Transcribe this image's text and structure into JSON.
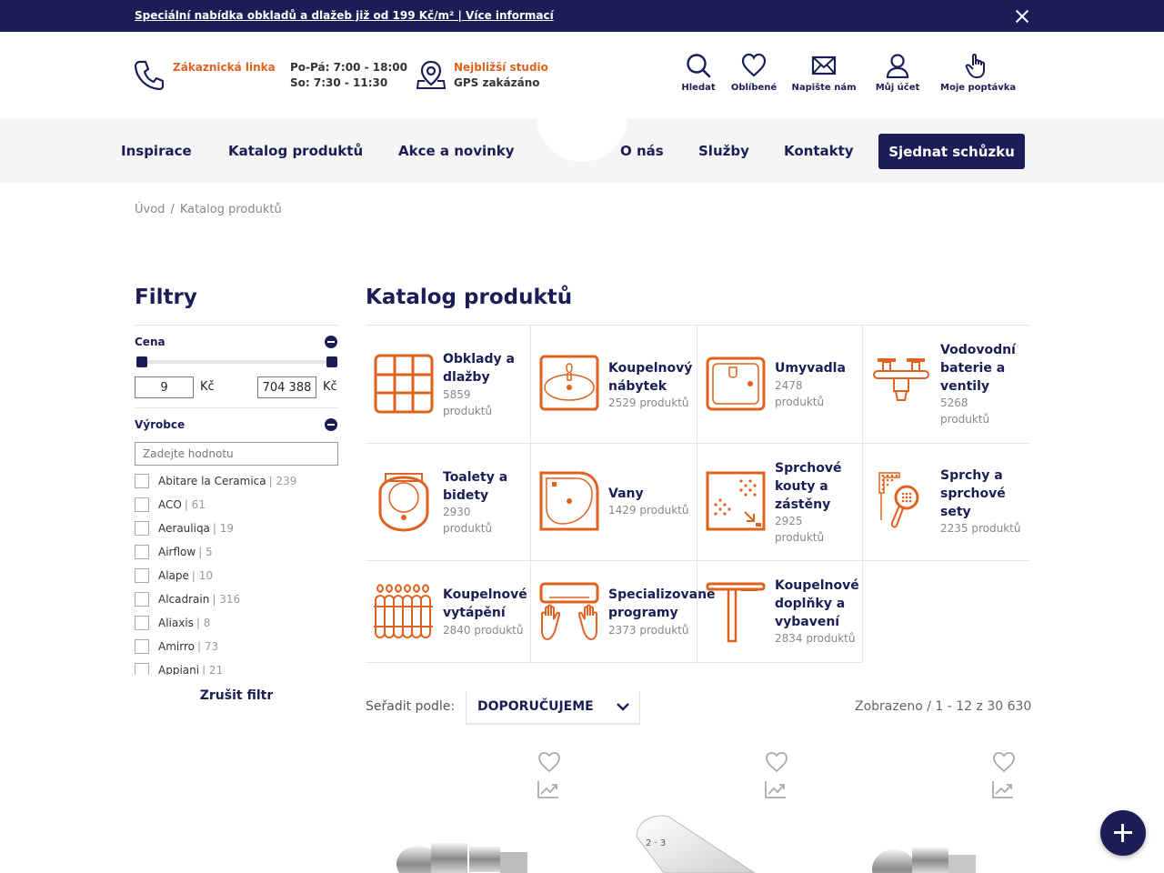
{
  "promo": {
    "text": "Speciální nabídka obkladů a dlažeb již od 199 Kč/m² | Více informací"
  },
  "header": {
    "hotline_label": "Zákaznická linka",
    "hours_weekday": "Po-Pá: 7:00 - 18:00",
    "hours_saturday": "So: 7:30 - 11:30",
    "studio_label": "Nejbližší studio",
    "studio_value": "GPS zakázáno",
    "tools": {
      "search": "Hledat",
      "favorites": "Oblíbené",
      "write": "Napište nám",
      "account": "Můj účet",
      "inquiry": "Moje poptávka"
    }
  },
  "nav": {
    "items": [
      "Inspirace",
      "Katalog produktů",
      "Akce a novinky",
      "O nás",
      "Služby",
      "Kontakty"
    ],
    "cta": "Sjednat schůzku"
  },
  "breadcrumb": {
    "home": "Úvod",
    "sep": "/",
    "current": "Katalog produktů"
  },
  "filters": {
    "title": "Filtry",
    "price": {
      "label": "Cena",
      "min": "9",
      "max": "704 388",
      "currency": "Kč"
    },
    "brand": {
      "label": "Výrobce",
      "placeholder": "Zadejte hodnotu"
    },
    "brands": [
      {
        "name": "Abitare la Ceramica",
        "count": "| 239"
      },
      {
        "name": "ACO",
        "count": "| 61"
      },
      {
        "name": "Aerauliqa",
        "count": "| 19"
      },
      {
        "name": "Airflow",
        "count": "| 5"
      },
      {
        "name": "Alape",
        "count": "| 10"
      },
      {
        "name": "Alcadrain",
        "count": "| 316"
      },
      {
        "name": "Aliaxis",
        "count": "| 8"
      },
      {
        "name": "Amirro",
        "count": "| 73"
      },
      {
        "name": "Appiani",
        "count": "| 21"
      }
    ],
    "clear": "Zrušit filtr"
  },
  "catalog": {
    "title": "Katalog produktů",
    "categories": [
      {
        "name1": "Obklady a",
        "name2": "dlažby",
        "name3": "",
        "count1": "5859",
        "count2": "produktů",
        "icon": "tiles-icon"
      },
      {
        "name1": "Koupelnový",
        "name2": "nábytek",
        "name3": "",
        "count1": "2529 produktů",
        "count2": "",
        "icon": "bathroom-furniture-icon"
      },
      {
        "name1": "Umyvadla",
        "name2": "",
        "name3": "",
        "count1": "2478",
        "count2": "produktů",
        "icon": "washbasin-icon"
      },
      {
        "name1": "Vodovodní",
        "name2": "baterie a",
        "name3": "ventily",
        "count1": "5268",
        "count2": "produktů",
        "icon": "faucet-icon"
      },
      {
        "name1": "Toalety a",
        "name2": "bidety",
        "name3": "",
        "count1": "2930",
        "count2": "produktů",
        "icon": "toilet-icon"
      },
      {
        "name1": "Vany",
        "name2": "",
        "name3": "",
        "count1": "1429 produktů",
        "count2": "",
        "icon": "bathtub-icon"
      },
      {
        "name1": "Sprchové",
        "name2": "kouty a",
        "name3": "zástěny",
        "count1": "2925",
        "count2": "produktů",
        "icon": "shower-enclosure-icon"
      },
      {
        "name1": "Sprchy a",
        "name2": "sprchové",
        "name3": "sety",
        "count1": "2235 produktů",
        "count2": "",
        "icon": "shower-set-icon"
      },
      {
        "name1": "Koupelnové",
        "name2": "vytápění",
        "name3": "",
        "count1": "2840 produktů",
        "count2": "",
        "icon": "radiator-icon"
      },
      {
        "name1": "Specializované",
        "name2": "programy",
        "name3": "",
        "count1": "2373 produktů",
        "count2": "",
        "icon": "hand-dryer-icon"
      },
      {
        "name1": "Koupelnové",
        "name2": "doplňky a",
        "name3": "vybavení",
        "count1": "2834 produktů",
        "count2": "",
        "icon": "accessories-icon"
      }
    ]
  },
  "listing": {
    "sort_label": "Seřadit podle:",
    "sort_value": "DOPORUČUJEME",
    "results": "Zobrazeno / 1 - 12 z 30 630"
  },
  "colors": {
    "brand": "#1c1c57",
    "accent": "#e0621f"
  }
}
